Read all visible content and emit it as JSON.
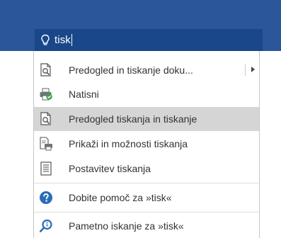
{
  "search": {
    "query": "tisk"
  },
  "menu": {
    "items": [
      {
        "label": "Predogled in tiskanje doku...",
        "icon": "print-preview-icon"
      },
      {
        "label": "Natisni",
        "icon": "printer-icon"
      },
      {
        "label": "Predogled tiskanja in tiskanje",
        "icon": "print-preview-icon"
      },
      {
        "label": "Prikaži in možnosti tiskanja",
        "icon": "print-options-icon"
      },
      {
        "label": "Postavitev tiskanja",
        "icon": "print-layout-icon"
      },
      {
        "label": "Dobite pomoč za »tisk«",
        "icon": "help-icon"
      },
      {
        "label": "Pametno iskanje za »tisk«",
        "icon": "smart-lookup-icon"
      }
    ]
  },
  "colors": {
    "ribbon": "#2b579a",
    "search_bg": "#19478a",
    "highlight": "#d5d5d5",
    "help_blue": "#2b6cb8"
  }
}
